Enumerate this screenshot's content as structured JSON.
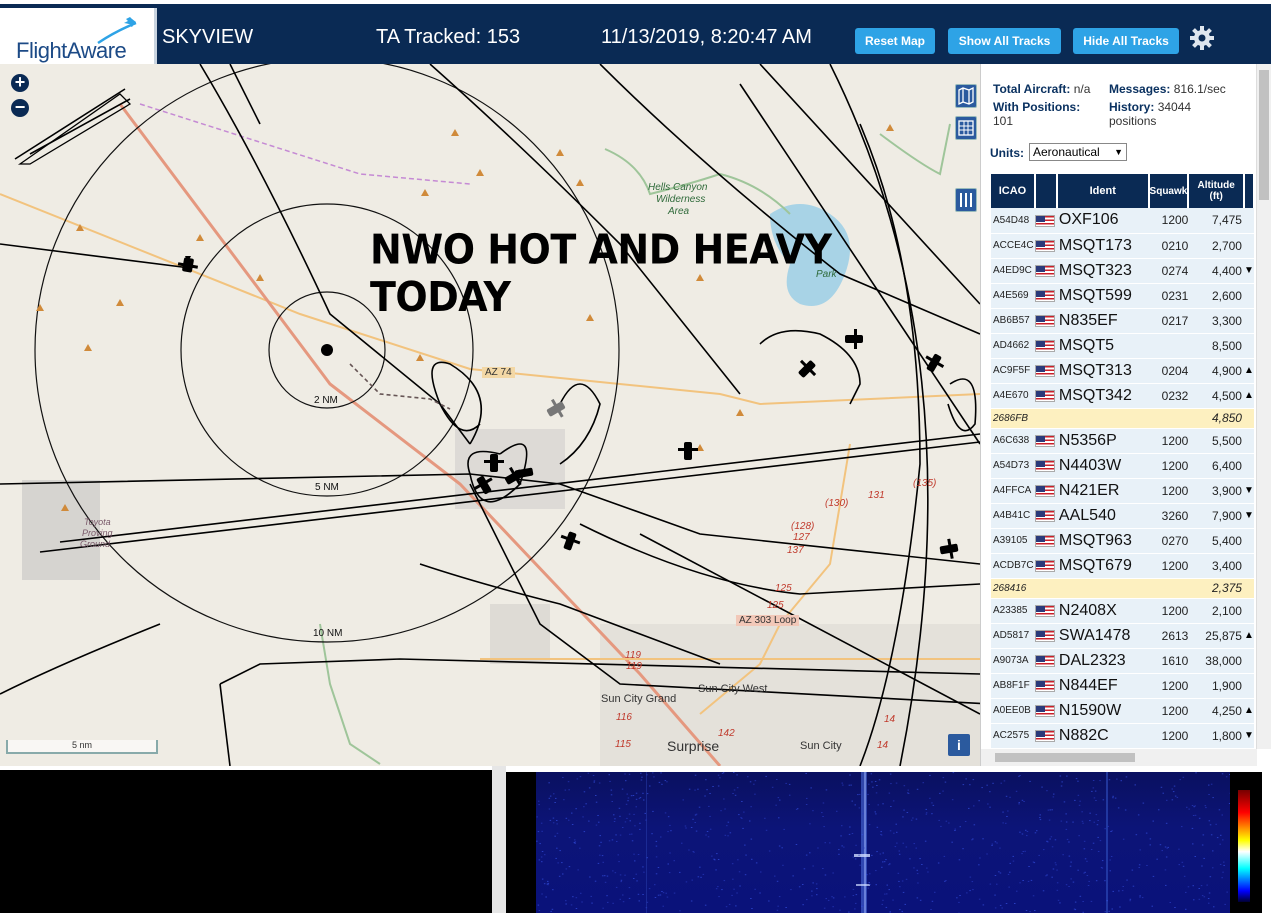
{
  "header": {
    "logo_text": "FlightAware",
    "app_name": "SKYVIEW",
    "ta_tracked_label": "TA Tracked: 153",
    "datetime": "11/13/2019, 8:20:47 AM",
    "buttons": {
      "reset_map": "Reset Map",
      "show_all_tracks": "Show All Tracks",
      "hide_all_tracks": "Hide All Tracks"
    }
  },
  "map": {
    "overlay_text": "NWO HOT AND HEAVY TODAY",
    "ring_labels": [
      "2 NM",
      "5 NM",
      "10 NM"
    ],
    "place_labels": {
      "hells_canyon": "Hells Canyon",
      "wilderness": "Wilderness",
      "area": "Area",
      "az74": "AZ 74",
      "az303": "AZ 303 Loop",
      "sun_city_grand": "Sun City Grand",
      "sun_city_west": "Sun City West",
      "sun_city": "Sun City",
      "surprise": "Surprise",
      "toyota_1": "Toyota",
      "toyota_2": "Proving",
      "toyota_3": "Ground",
      "park": "Park",
      "r128": "(128)",
      "r127": "127",
      "r137": "137",
      "r130": "(130)",
      "r131": "131",
      "r135": "(135)",
      "r125": "125",
      "r125b": "125",
      "r119": "119",
      "r119b": "119",
      "r116": "116",
      "r115": "115",
      "r142": "142",
      "r14": "14",
      "r14b": "14"
    },
    "scale_label": "5 nm",
    "info_label": "i"
  },
  "panel": {
    "total_aircraft_label": "Total Aircraft:",
    "total_aircraft_value": "n/a",
    "messages_label": "Messages:",
    "messages_value": "816.1/sec",
    "with_positions_label": "With Positions:",
    "with_positions_value": "101",
    "history_label": "History:",
    "history_value": "34044",
    "history_unit": "positions",
    "units_label": "Units:",
    "units_value": "Aeronautical",
    "table_headers": {
      "icao": "ICAO",
      "ident": "Ident",
      "squawk": "Squawk",
      "altitude": "Altitude",
      "altitude_unit": "(ft)"
    },
    "rows": [
      {
        "icao": "A54D48",
        "ident": "OXF106",
        "squawk": "1200",
        "alt": "7,475",
        "trend": ""
      },
      {
        "icao": "ACCE4C",
        "ident": "MSQT173",
        "squawk": "0210",
        "alt": "2,700",
        "trend": ""
      },
      {
        "icao": "A4ED9C",
        "ident": "MSQT323",
        "squawk": "0274",
        "alt": "4,400",
        "trend": "▼"
      },
      {
        "icao": "A4E569",
        "ident": "MSQT599",
        "squawk": "0231",
        "alt": "2,600",
        "trend": ""
      },
      {
        "icao": "AB6B57",
        "ident": "N835EF",
        "squawk": "0217",
        "alt": "3,300",
        "trend": ""
      },
      {
        "icao": "AD4662",
        "ident": "MSQT5",
        "squawk": "",
        "alt": "8,500",
        "trend": ""
      },
      {
        "icao": "AC9F5F",
        "ident": "MSQT313",
        "squawk": "0204",
        "alt": "4,900",
        "trend": "▲"
      },
      {
        "icao": "A4E670",
        "ident": "MSQT342",
        "squawk": "0232",
        "alt": "4,500",
        "trend": "▲"
      },
      {
        "icao": "2686FB",
        "ident": "",
        "squawk": "",
        "alt": "4,850",
        "trend": "",
        "nopos": true
      },
      {
        "icao": "A6C638",
        "ident": "N5356P",
        "squawk": "1200",
        "alt": "5,500",
        "trend": ""
      },
      {
        "icao": "A54D73",
        "ident": "N4403W",
        "squawk": "1200",
        "alt": "6,400",
        "trend": ""
      },
      {
        "icao": "A4FFCA",
        "ident": "N421ER",
        "squawk": "1200",
        "alt": "3,900",
        "trend": "▼"
      },
      {
        "icao": "A4B41C",
        "ident": "AAL540",
        "squawk": "3260",
        "alt": "7,900",
        "trend": "▼"
      },
      {
        "icao": "A39105",
        "ident": "MSQT963",
        "squawk": "0270",
        "alt": "5,400",
        "trend": ""
      },
      {
        "icao": "ACDB7C",
        "ident": "MSQT679",
        "squawk": "1200",
        "alt": "3,400",
        "trend": ""
      },
      {
        "icao": "268416",
        "ident": "",
        "squawk": "",
        "alt": "2,375",
        "trend": "",
        "nopos": true
      },
      {
        "icao": "A23385",
        "ident": "N2408X",
        "squawk": "1200",
        "alt": "2,100",
        "trend": ""
      },
      {
        "icao": "AD5817",
        "ident": "SWA1478",
        "squawk": "2613",
        "alt": "25,875",
        "trend": "▲"
      },
      {
        "icao": "A9073A",
        "ident": "DAL2323",
        "squawk": "1610",
        "alt": "38,000",
        "trend": ""
      },
      {
        "icao": "AB8F1F",
        "ident": "N844EF",
        "squawk": "1200",
        "alt": "1,900",
        "trend": ""
      },
      {
        "icao": "A0EE0B",
        "ident": "N1590W",
        "squawk": "1200",
        "alt": "4,250",
        "trend": "▲"
      },
      {
        "icao": "AC2575",
        "ident": "N882C",
        "squawk": "1200",
        "alt": "1,800",
        "trend": "▼"
      }
    ]
  },
  "colors": {
    "header_bg": "#0a2a54",
    "button_bg": "#2ea3e6",
    "row_bg": "#e8f1f8",
    "nopos_row_bg": "#fdf0c0",
    "map_bg": "#efece4"
  }
}
